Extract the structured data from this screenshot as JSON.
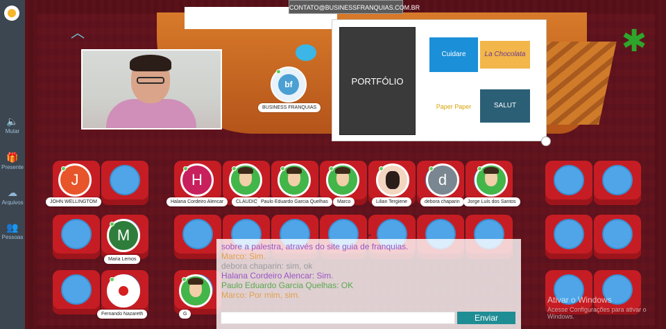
{
  "header": {
    "contact": "CONTATO@BUSINESSFRANQUIAS.COM.BR"
  },
  "sidebar": {
    "items": [
      {
        "label": "Mutar",
        "icon": "speaker-icon"
      },
      {
        "label": "Presente",
        "icon": "gift-icon"
      },
      {
        "label": "Arquivos",
        "icon": "cloud-upload-icon"
      },
      {
        "label": "Pessoas",
        "icon": "people-icon"
      }
    ]
  },
  "stage": {
    "presenter_label": "BUSINESS FRANQUIAS",
    "presenter_initials": "bf"
  },
  "portfolio": {
    "title": "PORTFÓLIO",
    "logos": [
      "Cuidare",
      "La Chocolata",
      "Paper Paper",
      "SALUT"
    ]
  },
  "attendees": {
    "row1": [
      {
        "name": "JOHN WELLINGTOM",
        "initial": "J",
        "color": "#e8552a"
      },
      {
        "name": "Halana Cordeiro Alencar",
        "initial": "H",
        "color": "#c7205c"
      },
      {
        "name": "CLAUDIO",
        "initial": "",
        "color": "#43b649"
      },
      {
        "name": "Paulo Eduardo Garcia Quelhas",
        "initial": "",
        "color": "#43b649"
      },
      {
        "name": "Marco",
        "initial": "",
        "color": "#43b649"
      },
      {
        "name": "Lilian Tergiene",
        "initial": "",
        "color": "#f3d5c0"
      },
      {
        "name": "debora chaparin",
        "initial": "d",
        "color": "#7b8790"
      },
      {
        "name": "Jorge Luís dos Santos",
        "initial": "",
        "color": "#43b649"
      }
    ],
    "row2": [
      {
        "name": "Maria Lemos",
        "initial": "M",
        "color": "#2f7d3b"
      }
    ],
    "row3": [
      {
        "name": "Fernando Nazareth",
        "initial": "",
        "color": "#ffffff"
      },
      {
        "name": "G",
        "initial": "",
        "color": "#43b649"
      }
    ]
  },
  "chat": {
    "messages": [
      {
        "text": "sobre a palestra, através do site guia de franquias.",
        "color": "#9a54c4"
      },
      {
        "text": "Marco: Sim.",
        "color": "#e0a050"
      },
      {
        "text": "debora chaparin: sim, ok",
        "color": "#9a9aa0"
      },
      {
        "text": "Halana Cordeiro Alencar: Sim.",
        "color": "#9a54c4"
      },
      {
        "text": "Paulo Eduardo Garcia Quelhas: OK",
        "color": "#5aa84d"
      },
      {
        "text": "Marco: Por mim, sim.",
        "color": "#e0a050"
      }
    ],
    "send_label": "Enviar",
    "input_value": ""
  },
  "watermark": {
    "line1": "Ativar o Windows",
    "line2": "Acesse Configurações para ativar o Windows."
  }
}
